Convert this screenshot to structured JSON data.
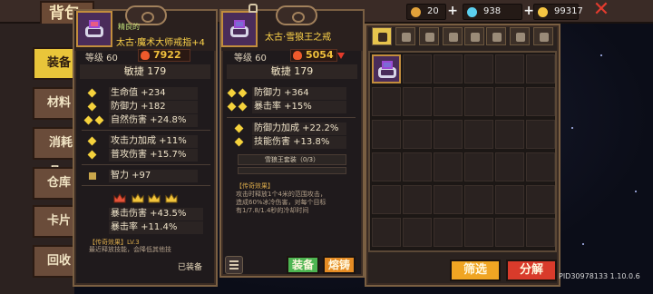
{
  "title": "背包",
  "currencies": [
    {
      "name": "coin-bag-icon",
      "value": "20",
      "color": "#e2a23a"
    },
    {
      "name": "gem-icon",
      "value": "938",
      "color": "#5bd0f0"
    },
    {
      "name": "gold-icon",
      "value": "99317",
      "color": "#f5c542"
    }
  ],
  "nav": [
    "装备",
    "材料",
    "消耗品",
    "仓库",
    "卡片",
    "回收"
  ],
  "left_card": {
    "quality": "精良的",
    "name": "太古·魔术大师戒指+4",
    "level": "等级 60",
    "power": "7922",
    "main_stat": "敏捷 179",
    "stats_a": [
      "生命值 +234",
      "防御力 +182",
      "自然伤害 +24.8%"
    ],
    "stats_b": [
      "攻击力加成 +11%",
      "普攻伤害 +15.7%"
    ],
    "stat_c": "智力 +97",
    "stats_d": [
      "暴击伤害 +43.5%",
      "暴击率 +11.4%"
    ],
    "legend_title": "【传奇效果】LV.3",
    "legend_text": "最近释放技能，会降低其他技",
    "equipped": "已装备"
  },
  "right_card": {
    "name": "太古·雪狼王之戒",
    "level": "等级 60",
    "power": "5054",
    "main_stat": "敏捷 179",
    "stats_a": [
      "防御力 +364",
      "暴击率 +15%"
    ],
    "stats_b": [
      "防御力加成 +22.2%",
      "技能伤害 +13.8%"
    ],
    "set_name": "雪狼王套装（0/3）",
    "legend_title": "【传奇效果】",
    "legend_text": [
      "攻击时释放1个4米的范围攻击，",
      "造成60%冰冷伤害，对每个目标",
      "有1/7.8/1.4秒的冷却时间"
    ],
    "btn_equip": "装备",
    "btn_smelt": "熔铸"
  },
  "bag": {
    "btn_filter": "筛选",
    "btn_decompose": "分解"
  },
  "pid": "PID30978133 1.10.0.6"
}
